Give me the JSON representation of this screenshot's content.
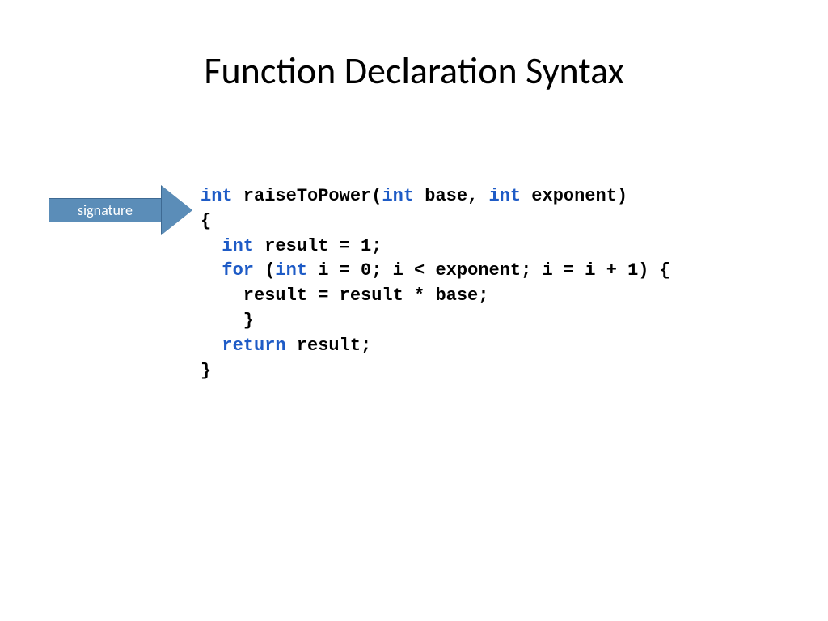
{
  "title": "Function Declaration Syntax",
  "callout": {
    "label": "signature"
  },
  "code": {
    "l1": {
      "kw1": "int",
      "t1": " raiseToPower(",
      "kw2": "int",
      "t2": " base, ",
      "kw3": "int",
      "t3": " exponent)"
    },
    "l2": "{",
    "l3": {
      "pad": "  ",
      "kw1": "int",
      "t1": " result = 1;"
    },
    "l4": {
      "pad": "  ",
      "kw1": "for",
      "t1": " (",
      "kw2": "int",
      "t2": " i = 0; i < exponent; i = i + 1) {"
    },
    "l5": "    result = result * base;",
    "l6": "    }",
    "l7": {
      "pad": "  ",
      "kw1": "return",
      "t1": " result;"
    },
    "l8": "}"
  }
}
